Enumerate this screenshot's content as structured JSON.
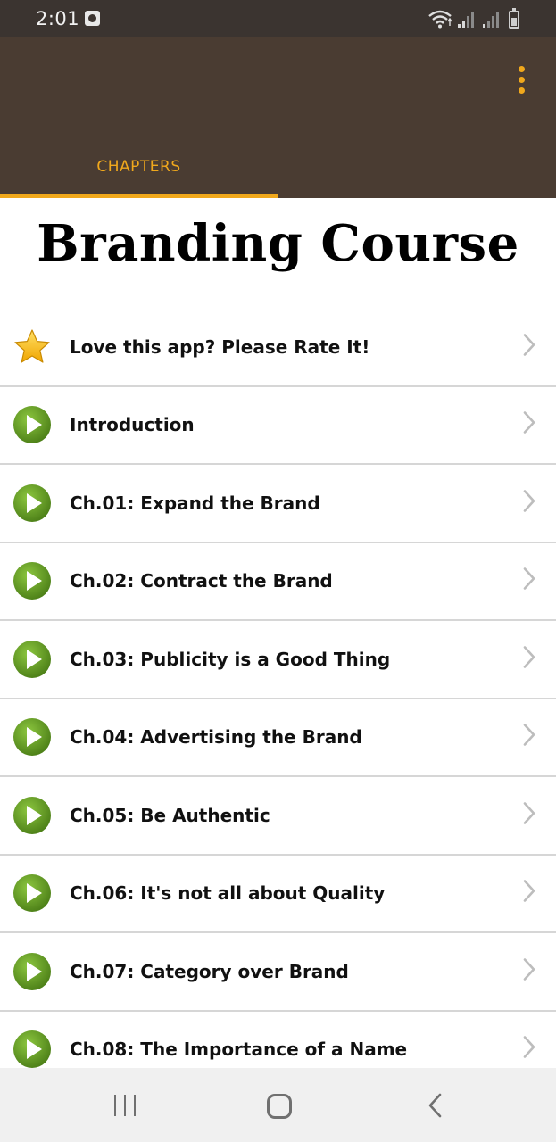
{
  "status_bar": {
    "time": "2:01",
    "icons": [
      "clock-icon",
      "wifi-icon",
      "signal-icon",
      "signal-icon",
      "battery-icon"
    ]
  },
  "app_bar": {
    "tab_label": "CHAPTERS",
    "menu_icon": "overflow-menu-icon"
  },
  "page": {
    "title": "Branding Course"
  },
  "list": {
    "items": [
      {
        "label": "Love this app? Please Rate It!",
        "icon": "star-icon"
      },
      {
        "label": "Introduction",
        "icon": "play-icon"
      },
      {
        "label": "Ch.01: Expand the Brand",
        "icon": "play-icon"
      },
      {
        "label": "Ch.02: Contract the Brand",
        "icon": "play-icon"
      },
      {
        "label": "Ch.03: Publicity is a Good Thing",
        "icon": "play-icon"
      },
      {
        "label": "Ch.04: Advertising the Brand",
        "icon": "play-icon"
      },
      {
        "label": "Ch.05: Be Authentic",
        "icon": "play-icon"
      },
      {
        "label": "Ch.06: It's not all about Quality",
        "icon": "play-icon"
      },
      {
        "label": "Ch.07: Category over Brand",
        "icon": "play-icon"
      },
      {
        "label": "Ch.08: The Importance of a Name",
        "icon": "play-icon"
      }
    ]
  },
  "nav_bar": {
    "icons": [
      "recents-icon",
      "home-icon",
      "back-icon"
    ]
  },
  "colors": {
    "status_bar_bg": "#3b3430",
    "app_bar_bg": "#4a3c32",
    "accent": "#f0a81c",
    "play_green": "#5b8f1e",
    "divider": "#d6d6d6",
    "nav_bar_bg": "#f0f0f0"
  }
}
